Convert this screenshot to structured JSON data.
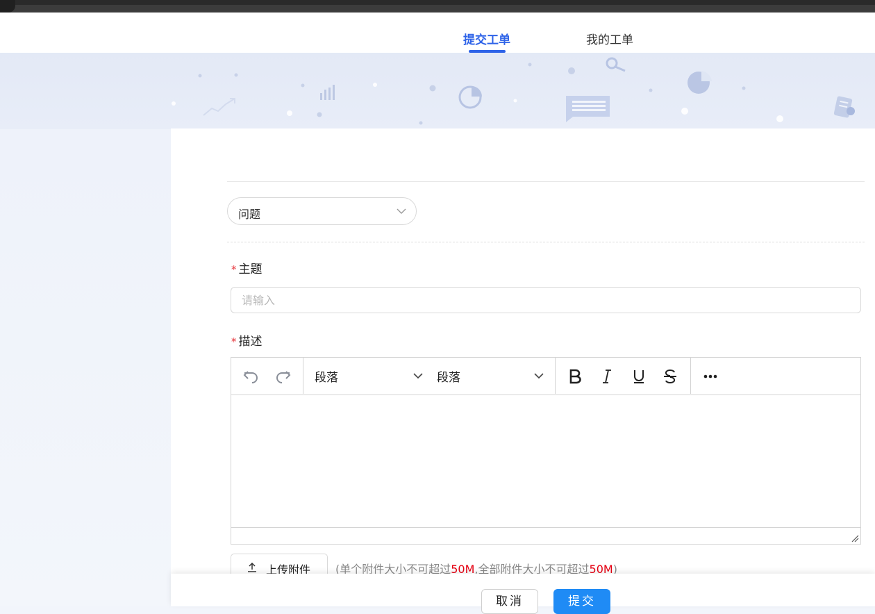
{
  "tabs": {
    "submit": "提交工单",
    "mine": "我的工单"
  },
  "form": {
    "type_select_value": "问题",
    "subject_label": "主题",
    "subject_required": "*",
    "subject_placeholder": "请输入",
    "desc_label": "描述",
    "desc_required": "*"
  },
  "editor": {
    "block_format_1": "段落",
    "block_format_2": "段落",
    "tools": [
      "undo-icon",
      "redo-icon",
      "bold-icon",
      "italic-icon",
      "underline-icon",
      "strikethrough-icon",
      "more-icon"
    ]
  },
  "upload": {
    "button_label": "上传附件",
    "hint_prefix": "(单个附件大小不可超过",
    "hint_limit_single": "50M",
    "hint_middle": ",全部附件大小不可超过",
    "hint_limit_total": "50M",
    "hint_suffix": ")"
  },
  "footer": {
    "cancel_label": "取消",
    "submit_label": "提交"
  },
  "colors": {
    "accent": "#2e63e8",
    "primary_button": "#1f8bf5",
    "required": "#e6393f",
    "hint_highlight": "#e60012"
  }
}
